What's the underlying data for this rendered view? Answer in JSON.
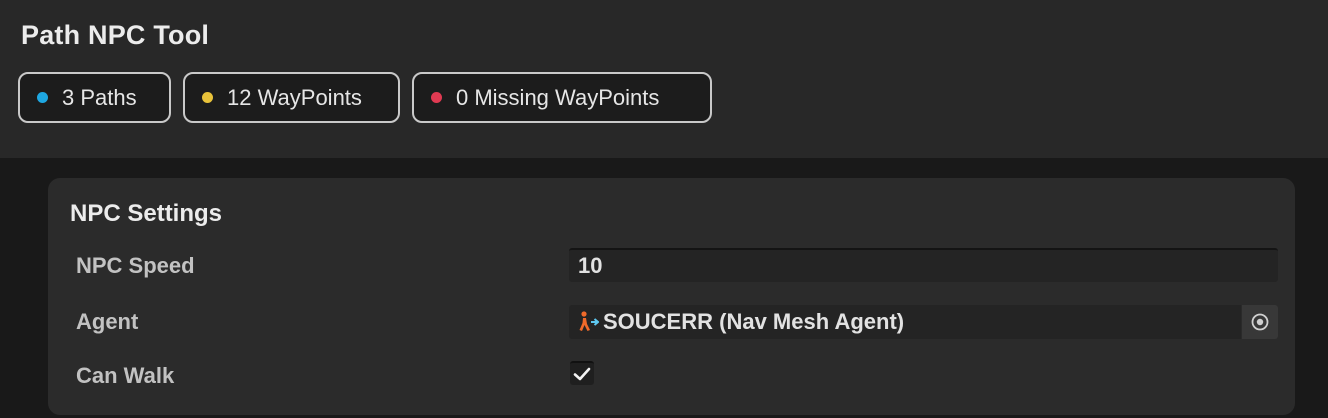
{
  "window": {
    "title": "Path NPC Tool"
  },
  "stats": [
    {
      "label": "3 Paths",
      "color": "#1ea7e1"
    },
    {
      "label": "12 WayPoints",
      "color": "#e8c23a"
    },
    {
      "label": "0 Missing WayPoints",
      "color": "#e03a52"
    }
  ],
  "npc_settings": {
    "title": "NPC Settings",
    "speed": {
      "label": "NPC Speed",
      "value": "10"
    },
    "agent": {
      "label": "Agent",
      "value": "SOUCERR (Nav Mesh Agent)",
      "icon": "nav-mesh-agent-icon",
      "picker_icon": "object-picker-icon"
    },
    "can_walk": {
      "label": "Can Walk",
      "checked": true,
      "icon": "checkmark-icon"
    }
  }
}
